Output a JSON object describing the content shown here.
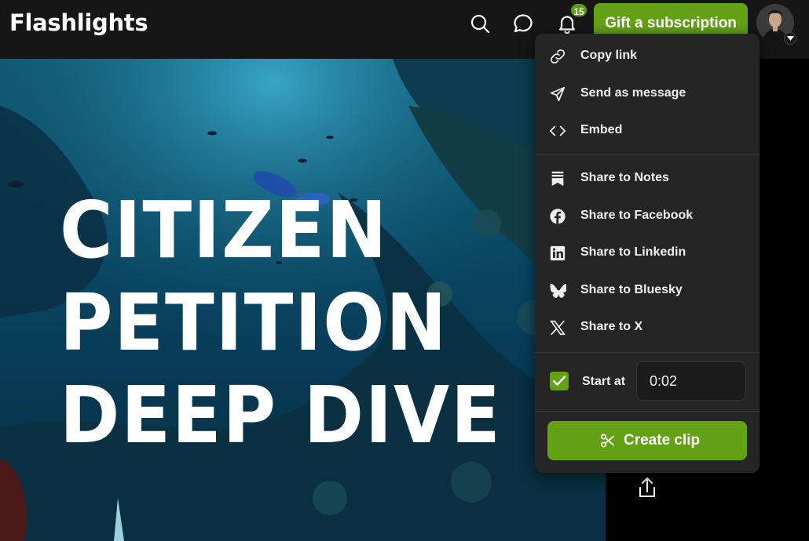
{
  "header": {
    "brand": "Flashlights",
    "notification_count": "15",
    "gift_button_label": "Gift a subscription"
  },
  "video": {
    "title_lines": [
      "CITIZEN",
      "PETITION",
      "DEEP DIVE"
    ]
  },
  "share_menu": {
    "items": [
      {
        "label": "Copy link",
        "icon": "link-icon"
      },
      {
        "label": "Send as message",
        "icon": "send-icon"
      },
      {
        "label": "Embed",
        "icon": "code-icon"
      },
      {
        "label": "Share to Notes",
        "icon": "notes-icon"
      },
      {
        "label": "Share to Facebook",
        "icon": "facebook-icon"
      },
      {
        "label": "Share to Linkedin",
        "icon": "linkedin-icon"
      },
      {
        "label": "Share to Bluesky",
        "icon": "bluesky-icon"
      },
      {
        "label": "Share to X",
        "icon": "x-icon"
      }
    ],
    "start_at_label": "Start at",
    "start_at_checked": true,
    "start_at_value": "0:02",
    "create_clip_label": "Create clip"
  },
  "colors": {
    "accent_green": "#63a215",
    "menu_background": "#252525",
    "header_background": "#161616"
  }
}
